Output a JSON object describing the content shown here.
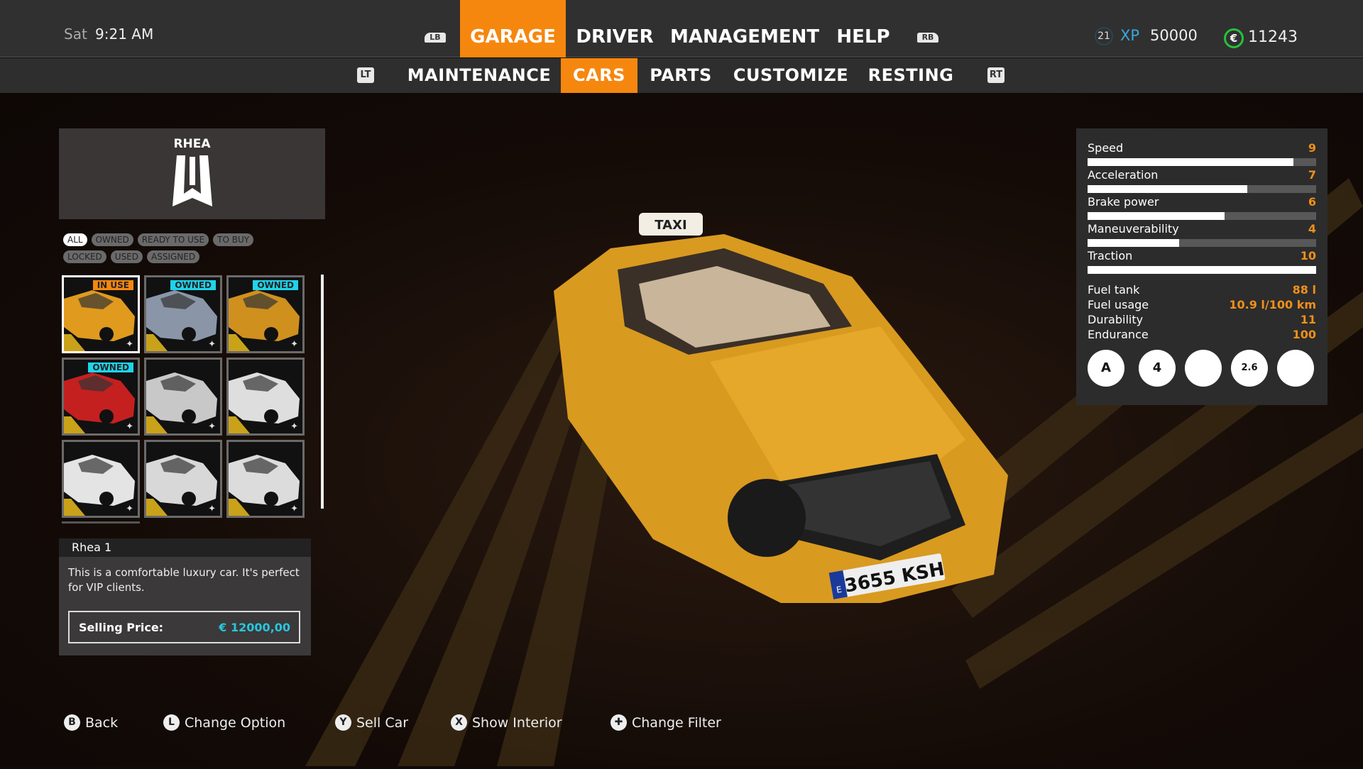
{
  "clock": {
    "day": "Sat",
    "time": "9:21 AM"
  },
  "nav": {
    "lb": "LB",
    "rb": "RB",
    "tabs": [
      {
        "label": "GARAGE",
        "active": true
      },
      {
        "label": "DRIVER"
      },
      {
        "label": "MANAGEMENT"
      },
      {
        "label": "HELP"
      }
    ]
  },
  "player": {
    "level": "21",
    "xp_label": "XP",
    "xp": "50000",
    "currency_symbol": "€",
    "money": "11243"
  },
  "subnav": {
    "lt": "LT",
    "rt": "RT",
    "tabs": [
      {
        "label": "MAINTENANCE"
      },
      {
        "label": "CARS",
        "active": true
      },
      {
        "label": "PARTS"
      },
      {
        "label": "CUSTOMIZE"
      },
      {
        "label": "RESTING"
      }
    ]
  },
  "brand": {
    "name": "RHEA"
  },
  "filters": [
    {
      "label": "ALL",
      "selected": true
    },
    {
      "label": "OWNED"
    },
    {
      "label": "READY TO USE"
    },
    {
      "label": "TO BUY"
    },
    {
      "label": "LOCKED"
    },
    {
      "label": "USED"
    },
    {
      "label": "ASSIGNED"
    }
  ],
  "cars": [
    {
      "badge": "IN USE",
      "badge_color": "#f5870f",
      "color": "#e09a1e",
      "selected": true
    },
    {
      "badge": "OWNED",
      "badge_color": "#1ed4ec",
      "color": "#8a96a8"
    },
    {
      "badge": "OWNED",
      "badge_color": "#1ed4ec",
      "color": "#d0901e"
    },
    {
      "badge": "OWNED",
      "badge_color": "#1ed4ec",
      "color": "#c42020"
    },
    {
      "badge": "",
      "color": "#c8c8c8"
    },
    {
      "badge": "",
      "color": "#dedede"
    },
    {
      "badge": "",
      "color": "#e4e4e4"
    },
    {
      "badge": "",
      "color": "#d8d8d8"
    },
    {
      "badge": "",
      "color": "#dcdcdc"
    }
  ],
  "details": {
    "name": "Rhea 1",
    "description": "This is a comfortable luxury car. It's perfect for VIP clients.",
    "price_label": "Selling Price:",
    "price": "€ 12000,00",
    "price_color": "#29c6e0"
  },
  "taxi": {
    "roof_sign": "TAXI",
    "plate": "3655 KSH",
    "plate_country": "E"
  },
  "stats": {
    "bars": [
      {
        "label": "Speed",
        "value": 9
      },
      {
        "label": "Acceleration",
        "value": 7
      },
      {
        "label": "Brake power",
        "value": 6
      },
      {
        "label": "Maneuverability",
        "value": 4
      },
      {
        "label": "Traction",
        "value": 10
      }
    ],
    "bar_max": 10,
    "specs": [
      {
        "label": "Fuel tank",
        "value": "88 l"
      },
      {
        "label": "Fuel usage",
        "value": "10.9 l/100 km"
      },
      {
        "label": "Durability",
        "value": "11"
      },
      {
        "label": "Endurance",
        "value": "100"
      }
    ],
    "features": [
      {
        "icon": "automatic-gearbox-icon",
        "text": "A"
      },
      {
        "icon": "four-seats-icon",
        "text": "4"
      },
      {
        "icon": "trunk-capacity-icon",
        "text": ""
      },
      {
        "icon": "weight-icon",
        "text": "2.6"
      },
      {
        "icon": "engine-icon",
        "text": ""
      }
    ]
  },
  "hints": [
    {
      "button": "B",
      "label": "Back"
    },
    {
      "button": "L",
      "label": "Change Option"
    },
    {
      "button": "Y",
      "label": "Sell Car"
    },
    {
      "button": "X",
      "label": "Show Interior"
    },
    {
      "button": "✚",
      "label": "Change Filter"
    }
  ]
}
